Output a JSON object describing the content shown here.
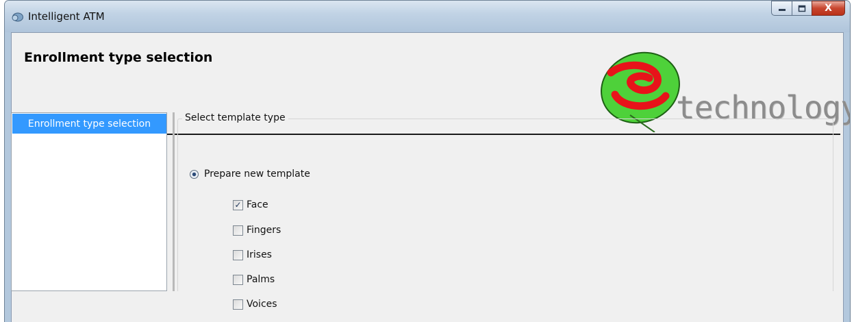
{
  "window": {
    "title": "Intelligent ATM",
    "controls": {
      "minimize": "▁",
      "maximize": "☐",
      "close": "X"
    }
  },
  "header": {
    "title": "Enrollment type selection",
    "logo_text": "technology"
  },
  "sidebar": {
    "items": [
      {
        "label": "Enrollment type selection",
        "selected": true
      }
    ]
  },
  "template_group": {
    "legend": "Select template type",
    "option": {
      "label": "Prepare new template",
      "selected": true
    },
    "modalities": [
      {
        "label": "Face",
        "checked": true
      },
      {
        "label": "Fingers",
        "checked": false
      },
      {
        "label": "Irises",
        "checked": false
      },
      {
        "label": "Palms",
        "checked": false
      },
      {
        "label": "Voices",
        "checked": false
      }
    ]
  },
  "icons": {
    "app": "atm-app-icon",
    "logo": "brand-logo-icon",
    "check_mark": "✓"
  },
  "colors": {
    "selection": "#3399ff",
    "logo_green": "#4ed13a",
    "logo_red": "#e8131a",
    "close_button": "#c8462f"
  }
}
